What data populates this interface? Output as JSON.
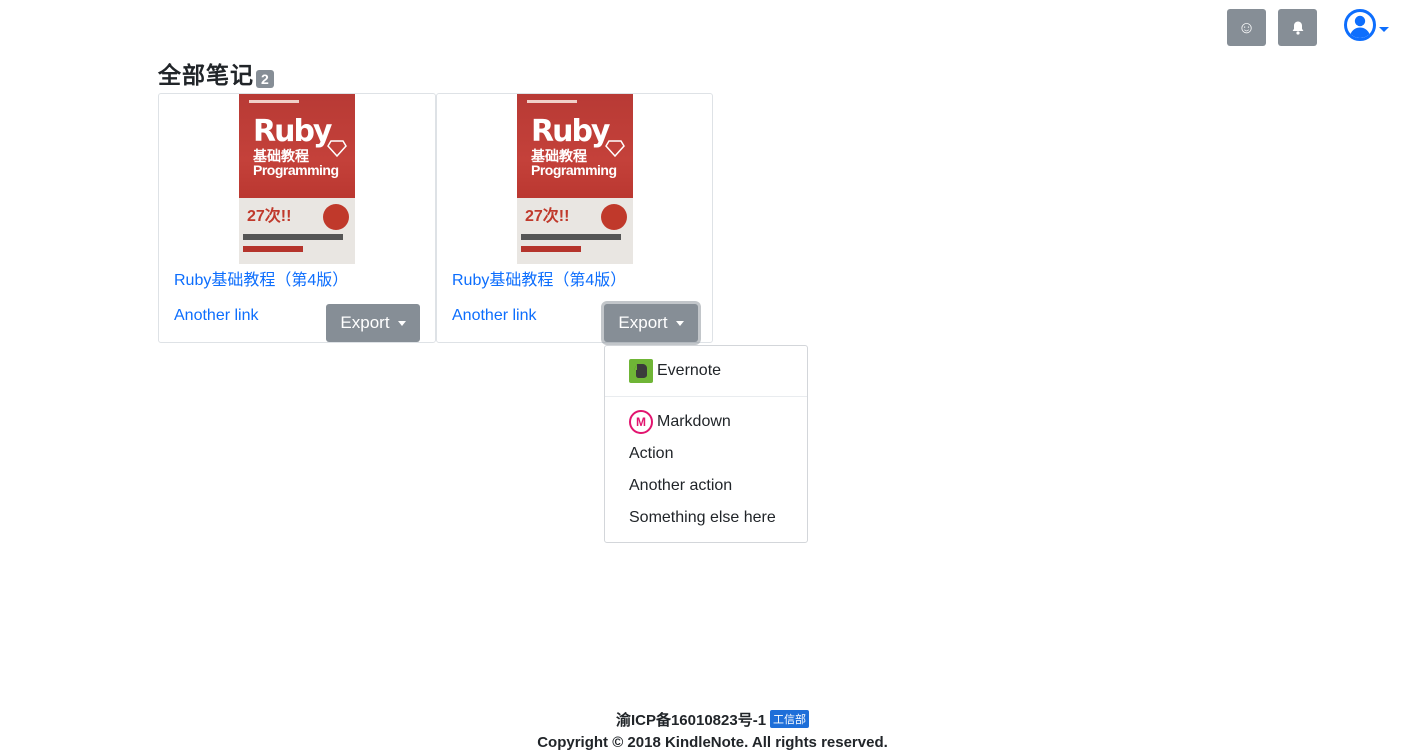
{
  "topbar": {
    "emoji_icon": "smiley-icon",
    "bell_icon": "bell-icon",
    "user_icon": "user-circle-icon",
    "button_color": "#868e96",
    "accent": "#0d6efd",
    "smiley_glyph": "☺"
  },
  "heading": {
    "title": "全部笔记",
    "count": "2"
  },
  "cards": [
    {
      "book_title": "Ruby基础教程（第4版）",
      "link": "Another link",
      "export_label": "Export",
      "cover": {
        "ruby": "Ruby",
        "cn": "基础教程",
        "prog": "Programming",
        "big": "27次!!"
      }
    },
    {
      "book_title": "Ruby基础教程（第4版）",
      "link": "Another link",
      "export_label": "Export",
      "cover": {
        "ruby": "Ruby",
        "cn": "基础教程",
        "prog": "Programming",
        "big": "27次!!"
      }
    }
  ],
  "dropdown": {
    "items": [
      {
        "label": "Evernote",
        "icon": "evernote-icon"
      },
      {
        "label": "Markdown",
        "icon": "markdown-icon"
      },
      {
        "label": "Action"
      },
      {
        "label": "Another action"
      },
      {
        "label": "Something else here"
      }
    ]
  },
  "footer": {
    "icp": "渝ICP备16010823号-1",
    "gov_badge": "工信部",
    "copyright": "Copyright © 2018 KindleNote. All rights reserved."
  }
}
